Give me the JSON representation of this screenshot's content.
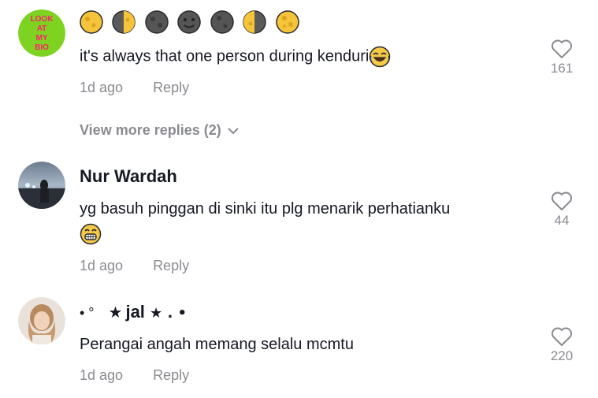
{
  "comments": [
    {
      "avatar_text": [
        "LOOK",
        "AT",
        "MY",
        "BIO"
      ],
      "username_icons": [
        "waxing-moon",
        "first-quarter-moon",
        "new-moon",
        "new-moon-face",
        "new-moon",
        "last-quarter-moon",
        "full-moon"
      ],
      "text": "it's always that one person during kenduri",
      "emoji": "tears-of-joy-emoji",
      "time": "1d ago",
      "reply_label": "Reply",
      "likes": "161",
      "view_more": "View more replies (2)"
    },
    {
      "username": "Nur Wardah",
      "text_line1": "yg basuh pinggan di sinki itu plg menarik perhatianku",
      "emoji": "grinning-emoji",
      "time": "1d ago",
      "reply_label": "Reply",
      "likes": "44"
    },
    {
      "username_prefix": "• °",
      "username_star": "★",
      "username": "jal",
      "username_suffix": "★ . •",
      "text": "Perangai angah memang selalu mcmtu",
      "time": "1d ago",
      "reply_label": "Reply",
      "likes": "220"
    }
  ],
  "colors": {
    "text": "#161823",
    "muted": "#8a8b91",
    "avatar_green": "#7ed321",
    "avatar_text": "#ff1f6a"
  }
}
